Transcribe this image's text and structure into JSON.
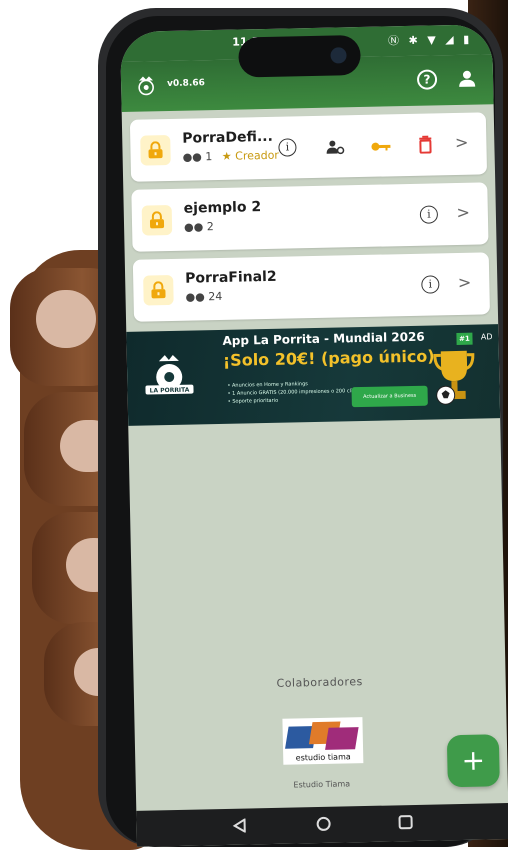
{
  "status": {
    "time": "11:2",
    "icons": "Ⓝ ✱ ▼ ◢ ▮"
  },
  "appbar": {
    "version": "v0.8.66"
  },
  "porras": [
    {
      "name": "PorraDefi...",
      "members": "1",
      "role": "Creador"
    },
    {
      "name": "ejemplo 2",
      "members": "2"
    },
    {
      "name": "PorraFinal2",
      "members": "24"
    }
  ],
  "ad": {
    "title": "App La Porrita - Mundial 2026",
    "price": "¡Solo 20€! (pago único)",
    "badge_text": "LA PORRITA",
    "bullets": [
      "Anuncios en Home y Rankings",
      "1 Anuncio GRATIS (20.000 impresiones o 200 clicks)",
      "Soporte prioritario"
    ],
    "cta": "Actualizar a Business",
    "tag": "#1",
    "ad_label": "AD"
  },
  "collaborators": {
    "heading": "Colaboradores",
    "partner_logo_text": "estudio tiama",
    "partner_name": "Estudio Tiama"
  },
  "fab": {
    "label": "+"
  },
  "colors": {
    "primary": "#2f6d34",
    "fab": "#3f9b4a",
    "lock_bg": "#fff3c8",
    "lock": "#f0a80c",
    "key": "#f0a80c",
    "delete": "#e53935",
    "creator": "#c89a12"
  },
  "icons": [
    "group-icon",
    "lock-icon",
    "info-icon",
    "manage-users-icon",
    "key-icon",
    "delete-icon",
    "chevron-right-icon",
    "help-icon",
    "user-icon",
    "add-icon"
  ]
}
